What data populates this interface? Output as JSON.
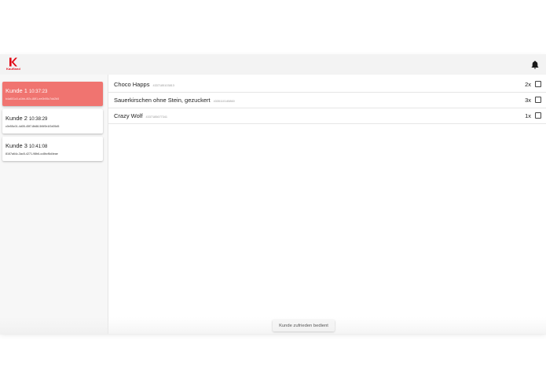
{
  "header": {
    "logo_text": "Kaufland",
    "brand_color": "#e10915",
    "notification_icon": "bell-icon"
  },
  "customers": [
    {
      "name": "Kunde 1",
      "time": "10:37:23",
      "uuid": "b4a601c0-a1bb-4f2c-88f1-ee0b95c7dd2b5",
      "active": true
    },
    {
      "name": "Kunde 2",
      "time": "10:38:29",
      "uuid": "c0e55c01-4d05-45f7-8b88-5f4f0b1f2d05d5",
      "active": false
    },
    {
      "name": "Kunde 3",
      "time": "10:41:08",
      "uuid": "8167a64c-3ac5-4271-98b6-cc8bcf6d4eae",
      "active": false
    }
  ],
  "items": [
    {
      "title": "Choco Happs",
      "ean": "4337185103813",
      "qty": "2x"
    },
    {
      "title": "Sauerkirschen ohne Stein, gezuckert",
      "ean": "4335110145860",
      "qty": "3x"
    },
    {
      "title": "Crazy Wolf",
      "ean": "4337185677341",
      "qty": "1x"
    }
  ],
  "actions": {
    "done_label": "Kunde zufrieden bedient"
  },
  "colors": {
    "active_card": "#f07470",
    "topbar": "#f3f3f3",
    "sidebar": "#f7f7f7"
  }
}
